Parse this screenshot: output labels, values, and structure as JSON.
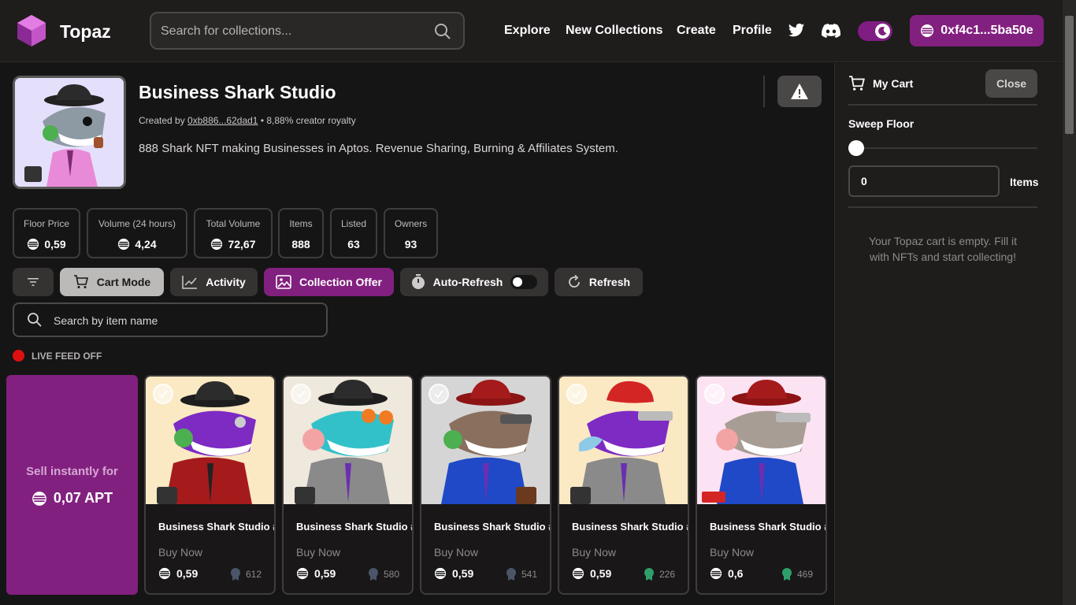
{
  "header": {
    "brand": "Topaz",
    "search_placeholder": "Search for collections...",
    "nav": [
      "Explore",
      "New Collections",
      "Create",
      "Profile"
    ],
    "wallet": "0xf4c1...5ba50e",
    "accent": "#82207f"
  },
  "collection": {
    "title": "Business Shark Studio",
    "created_prefix": "Created by",
    "creator": "0xb886...62dad1",
    "royalty": "• 8,88% creator royalty",
    "description": "888 Shark NFT making Businesses in Aptos. Revenue Sharing, Burning & Affiliates System."
  },
  "stats": [
    {
      "label": "Floor Price",
      "value": "0,59"
    },
    {
      "label": "Volume (24 hours)",
      "value": "4,24"
    },
    {
      "label": "Total Volume",
      "value": "72,67"
    },
    {
      "label": "Items",
      "value": "888"
    },
    {
      "label": "Listed",
      "value": "63"
    },
    {
      "label": "Owners",
      "value": "93"
    }
  ],
  "toolbar": {
    "cart_mode": "Cart Mode",
    "activity": "Activity",
    "collection_offer": "Collection Offer",
    "auto_refresh": "Auto-Refresh",
    "refresh": "Refresh"
  },
  "item_search_placeholder": "Search by item name",
  "live_feed": "LIVE FEED OFF",
  "sell": {
    "label": "Sell instantly for",
    "amount": "0,07 APT"
  },
  "cards": [
    {
      "name": "Business Shark Studio #",
      "action": "Buy Now",
      "price": "0,59",
      "rank": "612",
      "rank_color": "#4a5568"
    },
    {
      "name": "Business Shark Studio #",
      "action": "Buy Now",
      "price": "0,59",
      "rank": "580",
      "rank_color": "#4a5568"
    },
    {
      "name": "Business Shark Studio #",
      "action": "Buy Now",
      "price": "0,59",
      "rank": "541",
      "rank_color": "#4a5568"
    },
    {
      "name": "Business Shark Studio #",
      "action": "Buy Now",
      "price": "0,59",
      "rank": "226",
      "rank_color": "#2f9e6b"
    },
    {
      "name": "Business Shark Studio #",
      "action": "Buy Now",
      "price": "0,6",
      "rank": "469",
      "rank_color": "#2f9e6b"
    }
  ],
  "cart": {
    "title": "My Cart",
    "close": "Close",
    "sweep_floor": "Sweep Floor",
    "sweep_value": 0,
    "quantity": "0",
    "items_label": "Items",
    "empty_message": "Your Topaz cart is empty. Fill it with NFTs and start collecting!"
  }
}
